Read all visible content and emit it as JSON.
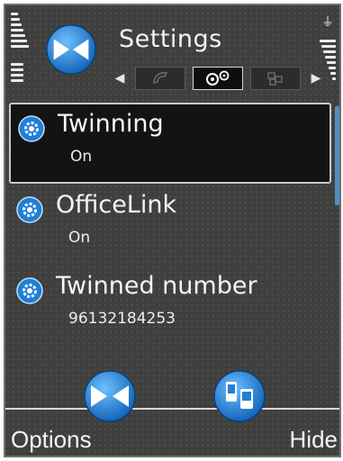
{
  "header": {
    "title": "Settings",
    "tabs": [
      {
        "icon": "phone-icon",
        "active": false
      },
      {
        "icon": "settings-gears-icon",
        "active": true
      },
      {
        "icon": "blocks-icon",
        "active": false
      }
    ]
  },
  "list": {
    "items": [
      {
        "label": "Twinning",
        "value": "On",
        "selected": true
      },
      {
        "label": "OfficeLink",
        "value": "On",
        "selected": false
      },
      {
        "label": "Twinned number",
        "value": "96132184253",
        "selected": false
      }
    ]
  },
  "softkeys": {
    "left": "Options",
    "right": "Hide"
  },
  "colors": {
    "accent_blue": "#1f7fd6",
    "background": "#3f3f3d",
    "selection": "#131312"
  }
}
